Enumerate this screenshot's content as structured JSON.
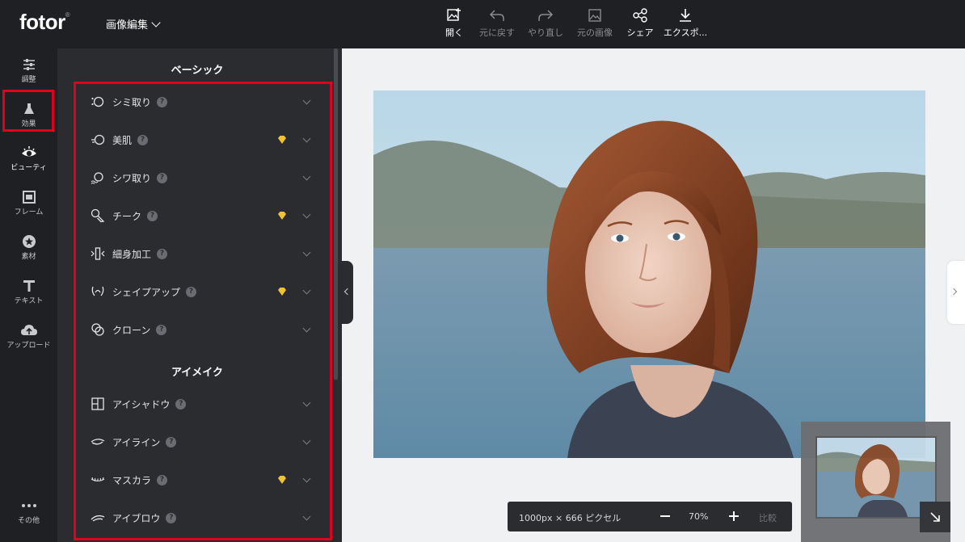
{
  "app": {
    "logo": "fotor",
    "logo_mark": "®",
    "mode_label": "画像編集"
  },
  "toolbar": [
    {
      "label": "開く",
      "icon": "open-image-icon",
      "enabled": true
    },
    {
      "label": "元に戻す",
      "icon": "undo-icon",
      "enabled": false
    },
    {
      "label": "やり直し",
      "icon": "redo-icon",
      "enabled": false
    },
    {
      "label": "元の画像",
      "icon": "original-image-icon",
      "enabled": false
    },
    {
      "label": "シェア",
      "icon": "share-icon",
      "enabled": true
    },
    {
      "label": "エクスポ...",
      "icon": "download-icon",
      "enabled": true
    }
  ],
  "leftnav": [
    {
      "label": "調整",
      "icon": "sliders-icon"
    },
    {
      "label": "効果",
      "icon": "flask-icon"
    },
    {
      "label": "ビューティ",
      "icon": "eye-icon",
      "active": true
    },
    {
      "label": "フレーム",
      "icon": "frame-icon"
    },
    {
      "label": "素材",
      "icon": "sticker-icon"
    },
    {
      "label": "テキスト",
      "icon": "text-icon"
    },
    {
      "label": "アップロード",
      "icon": "upload-cloud-icon"
    },
    {
      "label": "その他",
      "icon": "more-dots-icon"
    }
  ],
  "panel": {
    "section_basic": "ベーシック",
    "basic_items": [
      {
        "label": "シミ取り",
        "icon": "blemish-icon",
        "premium": false
      },
      {
        "label": "美肌",
        "icon": "smooth-skin-icon",
        "premium": true
      },
      {
        "label": "シワ取り",
        "icon": "wrinkle-icon",
        "premium": false
      },
      {
        "label": "チーク",
        "icon": "blush-icon",
        "premium": true
      },
      {
        "label": "細身加工",
        "icon": "slim-icon",
        "premium": false
      },
      {
        "label": "シェイプアップ",
        "icon": "reshape-icon",
        "premium": true
      },
      {
        "label": "クローン",
        "icon": "clone-icon",
        "premium": false
      }
    ],
    "section_eye": "アイメイク",
    "eye_items": [
      {
        "label": "アイシャドウ",
        "icon": "eyeshadow-icon",
        "premium": false
      },
      {
        "label": "アイライン",
        "icon": "eyeliner-icon",
        "premium": false
      },
      {
        "label": "マスカラ",
        "icon": "mascara-icon",
        "premium": true
      },
      {
        "label": "アイブロウ",
        "icon": "eyebrow-icon",
        "premium": false
      }
    ],
    "help_glyph": "?"
  },
  "zoom": {
    "dimensions": "1000px × 666 ピクセル",
    "percent": "70%",
    "compare": "比較"
  },
  "colors": {
    "highlight": "#e0001b",
    "premium": "#f2c230",
    "dark": "#1f2023",
    "panel": "#2b2c30"
  }
}
